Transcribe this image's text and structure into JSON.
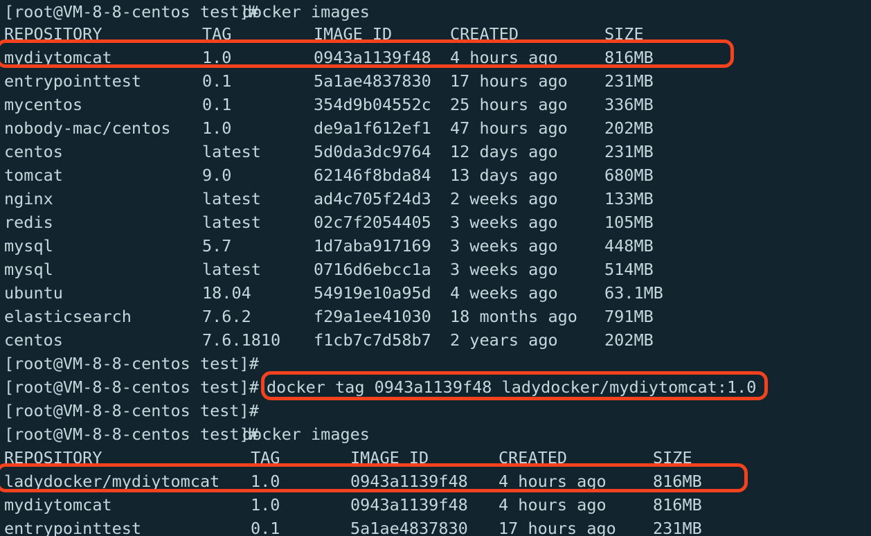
{
  "terminal": {
    "background_color": "#12252f",
    "text_color": "#c6d6dc",
    "highlight_color": "#f4421f",
    "prompt": "[root@VM-8-8-centos test]#",
    "hostname": "VM-8-8-centos",
    "user": "root",
    "cwd": "test"
  },
  "session": {
    "command_1": "docker images",
    "command_2": "docker tag 0943a1139f48 ladydocker/mydiytomcat:1.0",
    "command_3": "docker images"
  },
  "listing_1": {
    "headers": {
      "repository": "REPOSITORY",
      "tag": "TAG",
      "image_id": "IMAGE ID",
      "created": "CREATED",
      "size": "SIZE"
    },
    "rows": [
      {
        "repository": "mydiytomcat",
        "tag": "1.0",
        "image_id": "0943a1139f48",
        "created": "4 hours ago",
        "size": "816MB"
      },
      {
        "repository": "entrypointtest",
        "tag": "0.1",
        "image_id": "5a1ae4837830",
        "created": "17 hours ago",
        "size": "231MB"
      },
      {
        "repository": "mycentos",
        "tag": "0.1",
        "image_id": "354d9b04552c",
        "created": "25 hours ago",
        "size": "336MB"
      },
      {
        "repository": "nobody-mac/centos",
        "tag": "1.0",
        "image_id": "de9a1f612ef1",
        "created": "47 hours ago",
        "size": "202MB"
      },
      {
        "repository": "centos",
        "tag": "latest",
        "image_id": "5d0da3dc9764",
        "created": "12 days ago",
        "size": "231MB"
      },
      {
        "repository": "tomcat",
        "tag": "9.0",
        "image_id": "62146f8bda84",
        "created": "13 days ago",
        "size": "680MB"
      },
      {
        "repository": "nginx",
        "tag": "latest",
        "image_id": "ad4c705f24d3",
        "created": "2 weeks ago",
        "size": "133MB"
      },
      {
        "repository": "redis",
        "tag": "latest",
        "image_id": "02c7f2054405",
        "created": "3 weeks ago",
        "size": "105MB"
      },
      {
        "repository": "mysql",
        "tag": "5.7",
        "image_id": "1d7aba917169",
        "created": "3 weeks ago",
        "size": "448MB"
      },
      {
        "repository": "mysql",
        "tag": "latest",
        "image_id": "0716d6ebcc1a",
        "created": "3 weeks ago",
        "size": "514MB"
      },
      {
        "repository": "ubuntu",
        "tag": "18.04",
        "image_id": "54919e10a95d",
        "created": "4 weeks ago",
        "size": "63.1MB"
      },
      {
        "repository": "elasticsearch",
        "tag": "7.6.2",
        "image_id": "f29a1ee41030",
        "created": "18 months ago",
        "size": "791MB"
      },
      {
        "repository": "centos",
        "tag": "7.6.1810",
        "image_id": "f1cb7c7d58b7",
        "created": "2 years ago",
        "size": "202MB"
      }
    ]
  },
  "listing_2": {
    "headers": {
      "repository": "REPOSITORY",
      "tag": "TAG",
      "image_id": "IMAGE ID",
      "created": "CREATED",
      "size": "SIZE"
    },
    "rows": [
      {
        "repository": "ladydocker/mydiytomcat",
        "tag": "1.0",
        "image_id": "0943a1139f48",
        "created": "4 hours ago",
        "size": "816MB"
      },
      {
        "repository": "mydiytomcat",
        "tag": "1.0",
        "image_id": "0943a1139f48",
        "created": "4 hours ago",
        "size": "816MB"
      },
      {
        "repository": "entrypointtest",
        "tag": "0.1",
        "image_id": "5a1ae4837830",
        "created": "17 hours ago",
        "size": "231MB"
      }
    ]
  }
}
